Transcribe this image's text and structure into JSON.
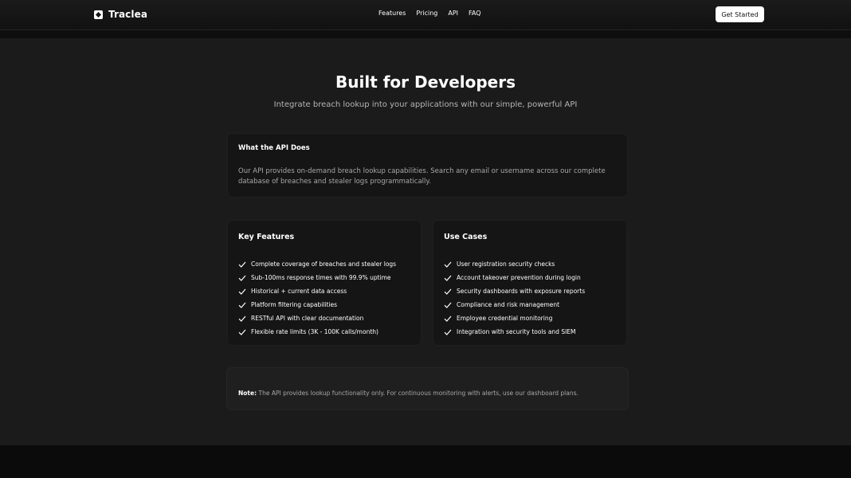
{
  "header": {
    "brand_name": "Traclea",
    "logo_icon": "traclea-logo-icon",
    "nav": [
      {
        "label": "Features"
      },
      {
        "label": "Pricing"
      },
      {
        "label": "API"
      },
      {
        "label": "FAQ"
      }
    ],
    "cta_label": "Get Started"
  },
  "hero": {
    "title": "Built for Developers",
    "subtitle": "Integrate breach lookup into your applications with our simple, powerful API"
  },
  "what_card": {
    "heading": "What the API Does",
    "body": "Our API provides on-demand breach lookup capabilities. Search any email or username across our complete database of breaches and stealer logs programmatically."
  },
  "features_card": {
    "heading": "Key Features",
    "items": [
      "Complete coverage of breaches and stealer logs",
      "Sub-100ms response times with 99.9% uptime",
      "Historical + current data access",
      "Platform filtering capabilities",
      "RESTful API with clear documentation",
      "Flexible rate limits (3K - 100K calls/month)"
    ]
  },
  "uses_card": {
    "heading": "Use Cases",
    "items": [
      "User registration security checks",
      "Account takeover prevention during login",
      "Security dashboards with exposure reports",
      "Compliance and risk management",
      "Employee credential monitoring",
      "Integration with security tools and SIEM"
    ]
  },
  "note": {
    "label": "Note:",
    "text": "The API provides lookup functionality only. For continuous monitoring with alerts, use our dashboard plans."
  },
  "colors": {
    "background": "#1b1b1b",
    "card": "#151515",
    "accent": "#ffffff"
  }
}
